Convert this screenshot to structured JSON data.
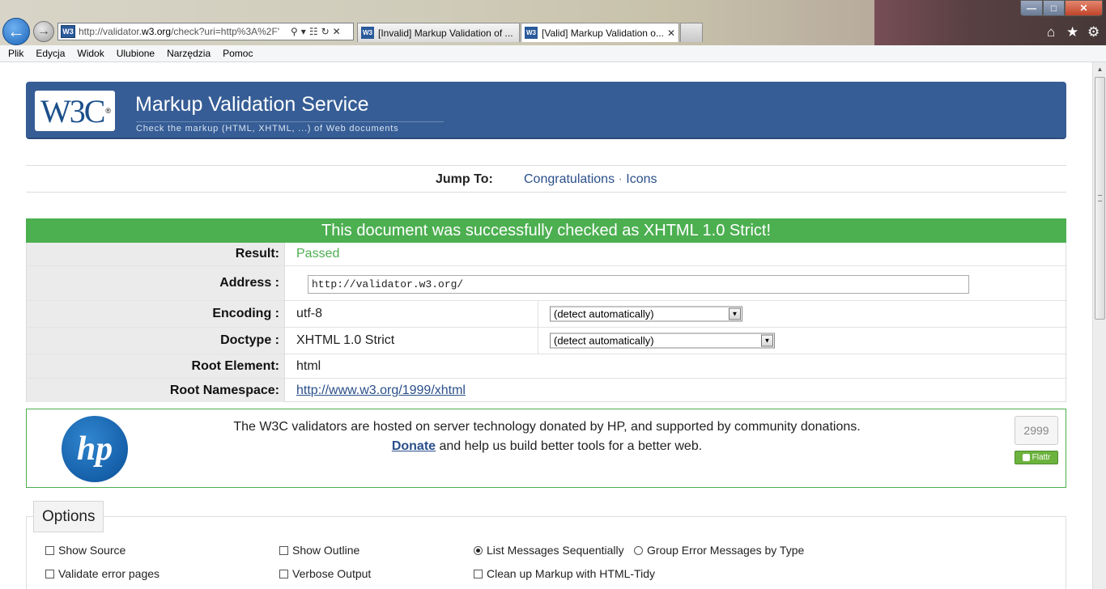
{
  "browser": {
    "address_url_prefix": "http://validator.",
    "address_url_domain": "w3.org",
    "address_url_rest": "/check?uri=http%3A%2F'",
    "tabs": [
      {
        "label": "[Invalid] Markup Validation of ..."
      },
      {
        "label": "[Valid] Markup Validation o..."
      }
    ],
    "favicon_text": "W3"
  },
  "menu": [
    "Plik",
    "Edycja",
    "Widok",
    "Ulubione",
    "Narzędzia",
    "Pomoc"
  ],
  "banner": {
    "logo_text": "W3C",
    "logo_mark": "®",
    "title": "Markup Validation Service",
    "subtitle": "Check the markup (HTML, XHTML, ...) of Web documents"
  },
  "jump": {
    "label": "Jump To:",
    "links": [
      "Congratulations",
      "Icons"
    ],
    "separator": " · "
  },
  "success_message": "This document was successfully checked as XHTML 1.0 Strict!",
  "results": {
    "result": {
      "label": "Result:",
      "value": "Passed",
      "color": "#4caf50"
    },
    "address": {
      "label": "Address :",
      "value": "http://validator.w3.org/"
    },
    "encoding": {
      "label": "Encoding :",
      "value": "utf-8",
      "select": "(detect automatically)"
    },
    "doctype": {
      "label": "Doctype :",
      "value": "XHTML 1.0 Strict",
      "select": "(detect automatically)"
    },
    "root_element": {
      "label": "Root Element:",
      "value": "html"
    },
    "root_namespace": {
      "label": "Root Namespace:",
      "value": "http://www.w3.org/1999/xhtml"
    }
  },
  "sponsor": {
    "logo_text": "hp",
    "line1": "The W3C validators are hosted on server technology donated by HP, and supported by community donations.",
    "donate_label": "Donate",
    "line2_rest": " and help us build better tools for a better web.",
    "flattr_count": "2999",
    "flattr_label": "Flattr"
  },
  "options": {
    "legend": "Options",
    "show_source": "Show Source",
    "show_outline": "Show Outline",
    "list_sequential": "List Messages Sequentially",
    "group_by_type": "Group Error Messages by Type",
    "validate_error_pages": "Validate error pages",
    "verbose_output": "Verbose Output",
    "clean_up_tidy": "Clean up Markup with HTML-Tidy"
  }
}
